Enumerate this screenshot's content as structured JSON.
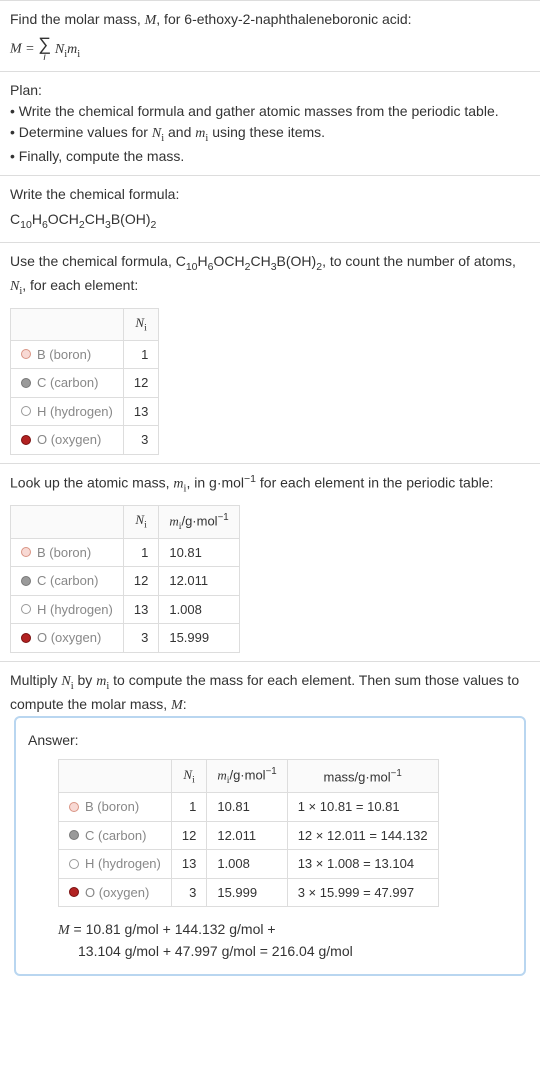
{
  "intro": {
    "line1": "Find the molar mass, ",
    "M": "M",
    "line1b": ", for 6-ethoxy-2-naphthaleneboronic acid:",
    "eq_lhs": "M = ",
    "eq_rhs_N": "N",
    "eq_rhs_i": "i",
    "eq_rhs_m": "m"
  },
  "plan": {
    "title": "Plan:",
    "b1": "• Write the chemical formula and gather atomic masses from the periodic table.",
    "b2_a": "• Determine values for ",
    "b2_N": "N",
    "b2_i": "i",
    "b2_and": " and ",
    "b2_m": "m",
    "b2_end": " using these items.",
    "b3": "• Finally, compute the mass."
  },
  "formula": {
    "title": "Write the chemical formula:",
    "c": "C",
    "s10": "10",
    "h": "H",
    "s6": "6",
    "o": "O",
    "ch2": "CH",
    "s2": "2",
    "ch3": "CH",
    "s3": "3",
    "b": "B(OH)",
    "s2b": "2"
  },
  "count": {
    "line_a": "Use the chemical formula, C",
    "line_b": "H",
    "line_c": "OCH",
    "line_d": "CH",
    "line_e": "B(OH)",
    "line_f": ", to count the number of atoms, ",
    "line_N": "N",
    "line_i": "i",
    "line_g": ", for each element:",
    "hdr_Ni_N": "N",
    "hdr_Ni_i": "i",
    "rows": [
      {
        "color": "#f8d9d4",
        "border": "#d99484",
        "name": "B (boron)",
        "n": "1"
      },
      {
        "color": "#9a9a9a",
        "border": "#777",
        "name": "C (carbon)",
        "n": "12"
      },
      {
        "color": "#ffffff",
        "border": "#999",
        "name": "H (hydrogen)",
        "n": "13"
      },
      {
        "color": "#b22222",
        "border": "#7a1010",
        "name": "O (oxygen)",
        "n": "3"
      }
    ]
  },
  "lookup": {
    "line_a": "Look up the atomic mass, ",
    "line_m": "m",
    "line_i": "i",
    "line_b": ", in g·mol",
    "line_exp": "−1",
    "line_c": " for each element in the periodic table:",
    "hdr_Ni_N": "N",
    "hdr_Ni_i": "i",
    "hdr_mi_m": "m",
    "hdr_mi_i": "i",
    "hdr_mi_unit": "/g·mol",
    "hdr_mi_exp": "−1",
    "rows": [
      {
        "color": "#f8d9d4",
        "border": "#d99484",
        "name": "B (boron)",
        "n": "1",
        "m": "10.81"
      },
      {
        "color": "#9a9a9a",
        "border": "#777",
        "name": "C (carbon)",
        "n": "12",
        "m": "12.011"
      },
      {
        "color": "#ffffff",
        "border": "#999",
        "name": "H (hydrogen)",
        "n": "13",
        "m": "1.008"
      },
      {
        "color": "#b22222",
        "border": "#7a1010",
        "name": "O (oxygen)",
        "n": "3",
        "m": "15.999"
      }
    ]
  },
  "mult": {
    "line_a": "Multiply ",
    "line_N": "N",
    "line_i": "i",
    "line_b": " by ",
    "line_m": "m",
    "line_c": " to compute the mass for each element. Then sum those values to compute the molar mass, ",
    "line_M": "M",
    "line_d": ":"
  },
  "answer": {
    "title": "Answer:",
    "hdr_Ni_N": "N",
    "hdr_Ni_i": "i",
    "hdr_mi_m": "m",
    "hdr_mi_i": "i",
    "hdr_mi_unit": "/g·mol",
    "hdr_mi_exp": "−1",
    "hdr_mass": "mass/g·mol",
    "hdr_mass_exp": "−1",
    "rows": [
      {
        "color": "#f8d9d4",
        "border": "#d99484",
        "name": "B (boron)",
        "n": "1",
        "m": "10.81",
        "mass": "1 × 10.81 = 10.81"
      },
      {
        "color": "#9a9a9a",
        "border": "#777",
        "name": "C (carbon)",
        "n": "12",
        "m": "12.011",
        "mass": "12 × 12.011 = 144.132"
      },
      {
        "color": "#ffffff",
        "border": "#999",
        "name": "H (hydrogen)",
        "n": "13",
        "m": "1.008",
        "mass": "13 × 1.008 = 13.104"
      },
      {
        "color": "#b22222",
        "border": "#7a1010",
        "name": "O (oxygen)",
        "n": "3",
        "m": "15.999",
        "mass": "3 × 15.999 = 47.997"
      }
    ],
    "result_M": "M",
    "result_a": " = 10.81 g/mol + 144.132 g/mol + ",
    "result_b": "13.104 g/mol + 47.997 g/mol = 216.04 g/mol"
  }
}
